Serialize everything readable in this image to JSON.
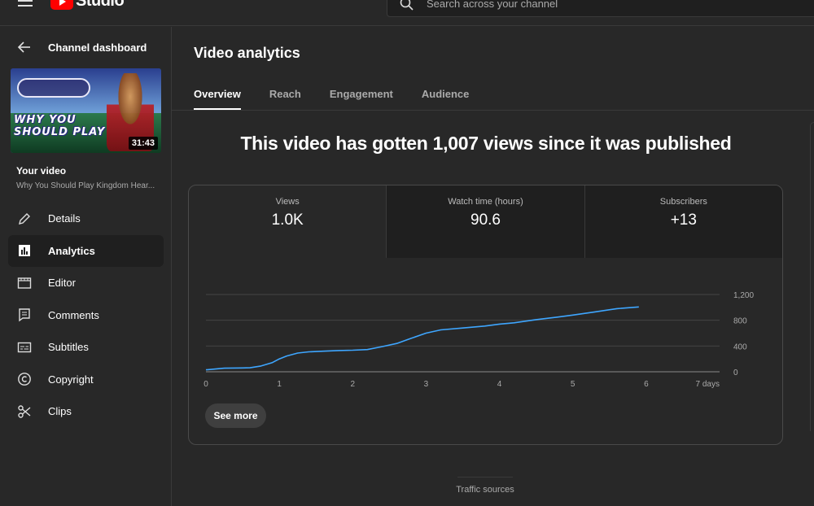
{
  "topbar": {
    "logo_text": "Studio",
    "search_placeholder": "Search across your channel"
  },
  "sidebar": {
    "back_label": "Channel dashboard",
    "thumbnail": {
      "duration": "31:43",
      "overlay_text": "WHY YOU SHOULD PLAY"
    },
    "your_video_label": "Your video",
    "video_title": "Why You Should Play Kingdom Hear...",
    "items": [
      {
        "label": "Details",
        "icon": "pencil-icon"
      },
      {
        "label": "Analytics",
        "icon": "bar-chart-icon",
        "active": true
      },
      {
        "label": "Editor",
        "icon": "film-icon"
      },
      {
        "label": "Comments",
        "icon": "comment-icon"
      },
      {
        "label": "Subtitles",
        "icon": "subtitles-icon"
      },
      {
        "label": "Copyright",
        "icon": "copyright-icon"
      },
      {
        "label": "Clips",
        "icon": "scissors-icon"
      }
    ]
  },
  "main": {
    "title": "Video analytics",
    "tabs": [
      {
        "label": "Overview",
        "active": true
      },
      {
        "label": "Reach"
      },
      {
        "label": "Engagement"
      },
      {
        "label": "Audience"
      }
    ],
    "headline": "This video has gotten 1,007 views since it was published",
    "metrics": [
      {
        "label": "Views",
        "value": "1.0K"
      },
      {
        "label": "Watch time (hours)",
        "value": "90.6"
      },
      {
        "label": "Subscribers",
        "value": "+13"
      }
    ],
    "see_more_label": "See more",
    "traffic_label": "Traffic sources"
  },
  "colors": {
    "background": "#282828",
    "line": "#3ea6ff",
    "accent_red": "#ff0000"
  },
  "chart_data": {
    "type": "line",
    "series": [
      {
        "x": [
          0,
          0.25,
          0.5,
          0.6,
          0.75,
          0.9,
          1.0,
          1.1,
          1.25,
          1.4,
          1.6,
          1.8,
          2.0,
          2.2,
          2.4,
          2.6,
          2.8,
          3.0,
          3.2,
          3.5,
          3.8,
          4.0,
          4.2,
          4.5,
          4.8,
          5.0,
          5.3,
          5.6,
          5.9
        ],
        "y": [
          30,
          55,
          60,
          62,
          90,
          140,
          200,
          245,
          290,
          310,
          320,
          330,
          335,
          345,
          390,
          440,
          520,
          600,
          650,
          680,
          710,
          740,
          760,
          810,
          850,
          880,
          930,
          980,
          1007
        ]
      }
    ],
    "xticks": [
      "0",
      "1",
      "2",
      "3",
      "4",
      "5",
      "6",
      "7 days"
    ],
    "xlim": [
      0,
      7
    ],
    "yticks": [
      "0",
      "400",
      "800",
      "1,200"
    ],
    "ylim": [
      0,
      1200
    ],
    "grid": true,
    "yaxis_side": "right"
  }
}
